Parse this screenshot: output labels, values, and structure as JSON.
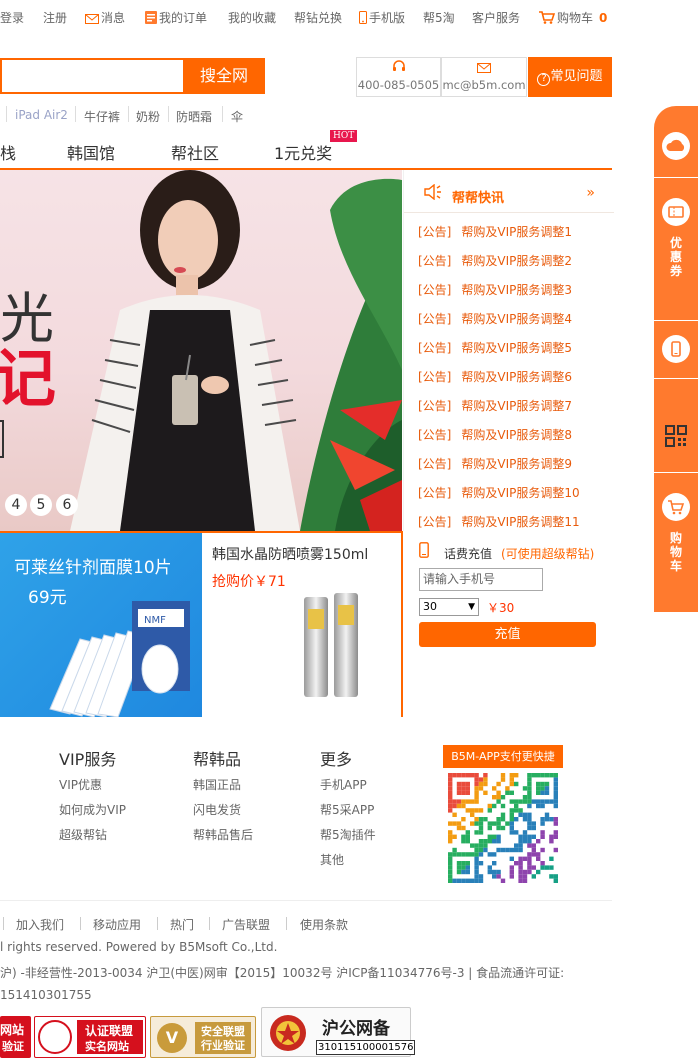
{
  "topbar": {
    "login": "登录",
    "register": "注册",
    "messages": "消息",
    "my_orders": "我的订单",
    "my_favorites": "我的收藏",
    "bangzuan_exchange": "帮钻兑换",
    "mobile": "手机版",
    "b5taobao": "帮5淘",
    "customer_service": "客户服务",
    "cart": "购物车",
    "cart_count": "0"
  },
  "search": {
    "button": "搜全网",
    "phone": "400-085-0505",
    "email": "mc@b5m.com",
    "faq": "常见问题"
  },
  "hot_keywords": [
    "iPad Air2",
    "牛仔裤",
    "奶粉",
    "防晒霜",
    "伞"
  ],
  "nav": {
    "items": [
      "栈",
      "韩国馆",
      "帮社区",
      "1元兑奖"
    ],
    "hot_tag": "HOT"
  },
  "banner": {
    "headline1": "光",
    "headline2": "记",
    "pages": [
      "4",
      "5",
      "6"
    ]
  },
  "news": {
    "title": "帮帮快讯",
    "more": "»",
    "items": [
      {
        "tag": "[公告]",
        "text": "帮购及VIP服务调整1"
      },
      {
        "tag": "[公告]",
        "text": "帮购及VIP服务调整2"
      },
      {
        "tag": "[公告]",
        "text": "帮购及VIP服务调整3"
      },
      {
        "tag": "[公告]",
        "text": "帮购及VIP服务调整4"
      },
      {
        "tag": "[公告]",
        "text": "帮购及VIP服务调整5"
      },
      {
        "tag": "[公告]",
        "text": "帮购及VIP服务调整6"
      },
      {
        "tag": "[公告]",
        "text": "帮购及VIP服务调整7"
      },
      {
        "tag": "[公告]",
        "text": "帮购及VIP服务调整8"
      },
      {
        "tag": "[公告]",
        "text": "帮购及VIP服务调整9"
      },
      {
        "tag": "[公告]",
        "text": "帮购及VIP服务调整10"
      },
      {
        "tag": "[公告]",
        "text": "帮购及VIP服务调整11"
      }
    ]
  },
  "promos": {
    "card1_title": "可莱丝针剂面膜10片",
    "card1_price": "69元",
    "card2_title": "韩国水晶防晒喷雾150ml",
    "card2_price": "抢购价￥71"
  },
  "recharge": {
    "label": "话费充值",
    "note": "(可使用超级帮钻)",
    "placeholder": "请输入手机号",
    "amount": "30",
    "price": "￥30",
    "button": "充值"
  },
  "footer": {
    "columns": [
      {
        "title": "VIP服务",
        "links": [
          "VIP优惠",
          "如何成为VIP",
          "超级帮钻"
        ]
      },
      {
        "title": "帮韩品",
        "links": [
          "韩国正品",
          "闪电发货",
          "帮韩品售后"
        ]
      },
      {
        "title": "更多",
        "links": [
          "手机APP",
          "帮5采APP",
          "帮5淘插件",
          "其他"
        ]
      }
    ],
    "qr_caption": "B5M-APP支付更快捷",
    "links": [
      "加入我们",
      "移动应用",
      "热门",
      "广告联盟",
      "使用条款"
    ],
    "copyright": "l rights reserved. Powered by B5Msoft Co.,Ltd.",
    "license": "沪) -非经营性-2013-0034 沪卫(中医)网审【2015】10032号 沪ICP备11034776号-3 | 食品流通许可证:",
    "license2": "151410301755",
    "badges": {
      "b1": "网站",
      "b1_sub": "验证",
      "b2": "认证联盟",
      "b2_sub": "实名网站",
      "b3": "安全联盟",
      "b3_sub": "行业验证",
      "b4": "沪公网备",
      "b4_num": "310115100001576"
    }
  },
  "sidebar": {
    "coupon": "优惠券",
    "cart": "购物车"
  },
  "colors": {
    "accent": "#ff6600",
    "news_text": "#e85b0c",
    "price_red": "#ff3300",
    "promo_blue": "#2196e3"
  }
}
